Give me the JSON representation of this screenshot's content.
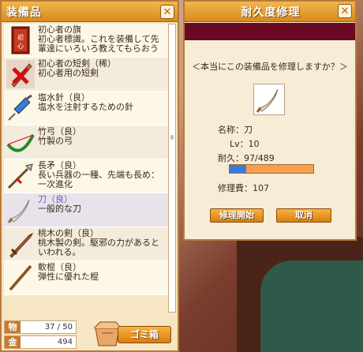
{
  "inventory": {
    "title": "装備品",
    "items": [
      {
        "icon": "beginner-flag-icon",
        "line1": "初心者の旗",
        "line2": "初心者標識。これを装備して先",
        "line3": "輩達にいろいろ教えてもらおう"
      },
      {
        "icon": "short-sword-broken-icon",
        "line1": "初心者の短剣（稀）",
        "line2": "初心者用の短剣",
        "line3": ""
      },
      {
        "icon": "syringe-icon",
        "line1": "塩水針（良）",
        "line2": "塩水を注射するための針",
        "line3": ""
      },
      {
        "icon": "bamboo-bow-icon",
        "line1": "竹弓（良）",
        "line2": "竹製の弓",
        "line3": ""
      },
      {
        "icon": "spear-icon",
        "line1": "長矛（良）",
        "line2": "長い兵器の一種、先端も長め：",
        "line3": "一次進化"
      },
      {
        "icon": "katana-icon",
        "line1": "刀（良）",
        "line2": "一般的な刀",
        "line3": ""
      },
      {
        "icon": "peach-wood-sword-icon",
        "line1": "桃木の剣（良）",
        "line2": "桃木製の剣。駆邪の力があると",
        "line3": "いわれる。"
      },
      {
        "icon": "staff-icon",
        "line1": "軟棍（良）",
        "line2": "弾性に優れた棍",
        "line3": ""
      }
    ],
    "stats": {
      "item_label": "物",
      "item_value": "37 / 50",
      "money_label": "金",
      "money_value": "494"
    },
    "trash_label": "ゴミ箱"
  },
  "repair": {
    "title": "耐久度修理",
    "prompt": "＜本当にこの装備品を修理しますか？＞",
    "name_label": "名称：刀",
    "level_label": "Lv：10",
    "durability_label": "耐久：97/489",
    "durability_fraction": 0.198,
    "cost_label": "修理費：107",
    "start_button": "修理開始",
    "cancel_button": "取消"
  },
  "colors": {
    "title_bar": "#e89a2a",
    "banner": "#6a0a22",
    "bar_fill": "#3a7ad8",
    "selected_name": "#7a58b8"
  }
}
